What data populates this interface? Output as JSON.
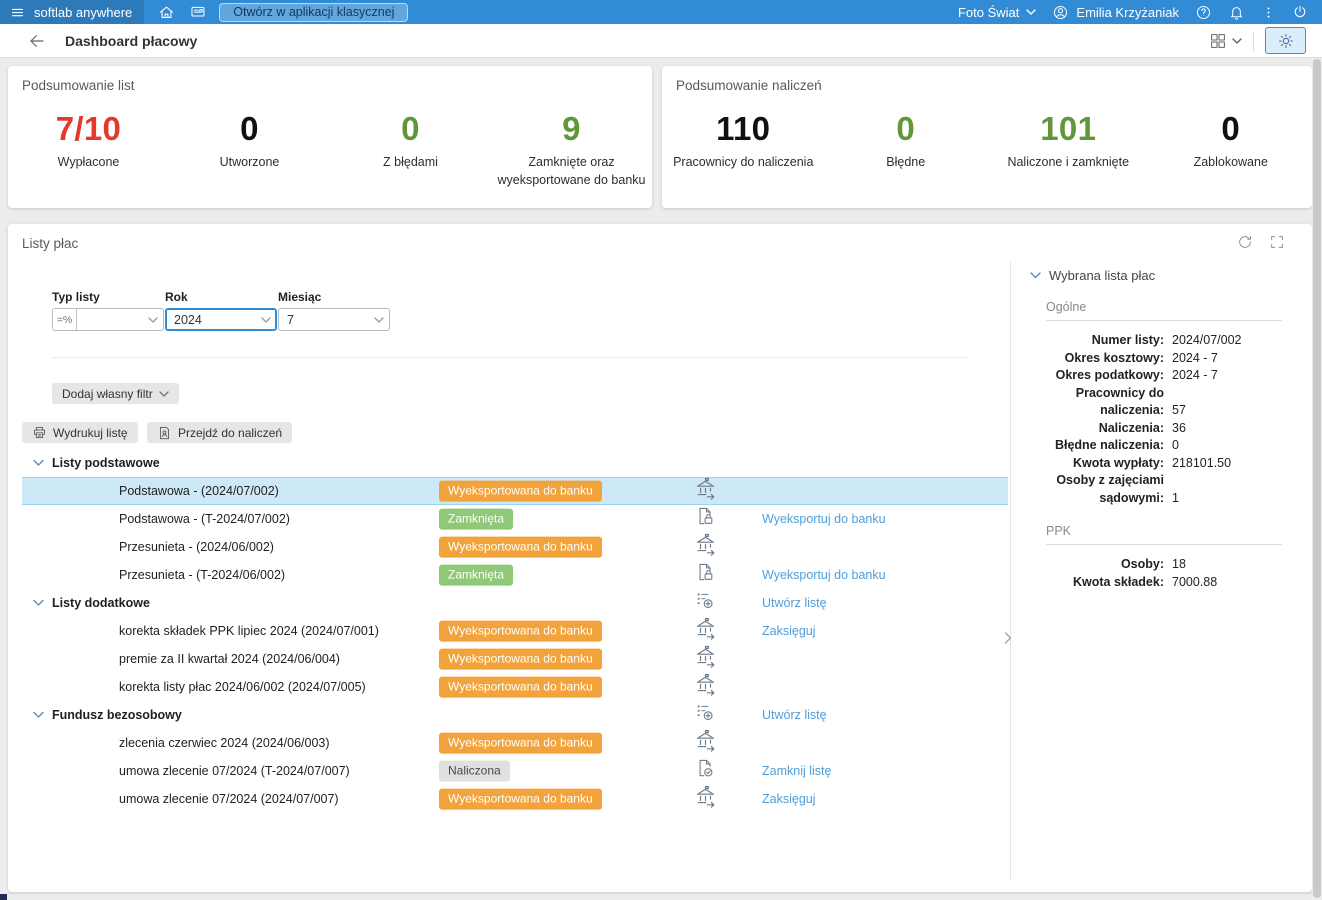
{
  "topbar": {
    "brand": "softlab anywhere",
    "open_classic_button": "Otwórz w aplikacji klasycznej",
    "company": "Foto Świat",
    "user": "Emilia Krzyżaniak"
  },
  "header": {
    "title": "Dashboard płacowy"
  },
  "summary_lists": {
    "title": "Podsumowanie list",
    "stats": [
      {
        "value": "7/10",
        "label": "Wypłacone",
        "color": "#e5392c"
      },
      {
        "value": "0",
        "label": "Utworzone",
        "color": "#111111"
      },
      {
        "value": "0",
        "label": "Z błędami",
        "color": "#61963b"
      },
      {
        "value": "9",
        "label": "Zamknięte oraz wyeksportowane do banku",
        "color": "#61963b"
      }
    ]
  },
  "summary_calcs": {
    "title": "Podsumowanie naliczeń",
    "stats": [
      {
        "value": "110",
        "label": "Pracownicy do naliczenia",
        "color": "#111111"
      },
      {
        "value": "0",
        "label": "Błędne",
        "color": "#61963b"
      },
      {
        "value": "101",
        "label": "Naliczone i zamknięte",
        "color": "#61963b"
      },
      {
        "value": "0",
        "label": "Zablokowane",
        "color": "#111111"
      }
    ]
  },
  "payroll": {
    "title": "Listy płac",
    "filters": {
      "type_label": "Typ listy",
      "operator_glyph": "=%",
      "type_value": "",
      "year_label": "Rok",
      "year_value": "2024",
      "month_label": "Miesiąc",
      "month_value": "7"
    },
    "add_filter_button": "Dodaj własny filtr",
    "print_button": "Wydrukuj listę",
    "goto_calcs_button": "Przejdź do naliczeń",
    "groups": [
      {
        "label": "Listy podstawowe",
        "icon": null,
        "action": "",
        "rows": [
          {
            "name": "Podstawowa - (2024/07/002)",
            "status": "Wyeksportowana do banku",
            "status_type": "exported",
            "icon": "bank-export-icon",
            "action": "",
            "selected": true
          },
          {
            "name": "Podstawowa - (T-2024/07/002)",
            "status": "Zamknięta",
            "status_type": "closed",
            "icon": "doc-lock-icon",
            "action": "Wyeksportuj do banku",
            "selected": false
          },
          {
            "name": "Przesunieta - (2024/06/002)",
            "status": "Wyeksportowana do banku",
            "status_type": "exported",
            "icon": "bank-export-icon",
            "action": "",
            "selected": false
          },
          {
            "name": "Przesunieta - (T-2024/06/002)",
            "status": "Zamknięta",
            "status_type": "closed",
            "icon": "doc-lock-icon",
            "action": "Wyeksportuj do banku",
            "selected": false
          }
        ]
      },
      {
        "label": "Listy dodatkowe",
        "icon": "list-add-icon",
        "action": "Utwórz listę",
        "rows": [
          {
            "name": "korekta składek PPK lipiec 2024 (2024/07/001)",
            "status": "Wyeksportowana do banku",
            "status_type": "exported",
            "icon": "bank-export-icon",
            "action": "Zaksięguj",
            "selected": false
          },
          {
            "name": "premie za II kwartał 2024 (2024/06/004)",
            "status": "Wyeksportowana do banku",
            "status_type": "exported",
            "icon": "bank-export-icon",
            "action": "",
            "selected": false
          },
          {
            "name": "korekta listy płac 2024/06/002 (2024/07/005)",
            "status": "Wyeksportowana do banku",
            "status_type": "exported",
            "icon": "bank-export-icon",
            "action": "",
            "selected": false
          }
        ]
      },
      {
        "label": "Fundusz bezosobowy",
        "icon": "list-add-icon",
        "action": "Utwórz listę",
        "rows": [
          {
            "name": "zlecenia czerwiec 2024 (2024/06/003)",
            "status": "Wyeksportowana do banku",
            "status_type": "exported",
            "icon": "bank-export-icon",
            "action": "",
            "selected": false
          },
          {
            "name": "umowa zlecenie 07/2024 (T-2024/07/007)",
            "status": "Naliczona",
            "status_type": "calculated",
            "icon": "doc-check-icon",
            "action": "Zamknij listę",
            "selected": false
          },
          {
            "name": "umowa zlecenie 07/2024 (2024/07/007)",
            "status": "Wyeksportowana do banku",
            "status_type": "exported",
            "icon": "bank-export-icon",
            "action": "Zaksięguj",
            "selected": false
          }
        ]
      }
    ]
  },
  "details_panel": {
    "title": "Wybrana lista płac",
    "sections": [
      {
        "heading": "Ogólne",
        "rows": [
          {
            "label": "Numer listy:",
            "value": "2024/07/002"
          },
          {
            "label": "Okres kosztowy:",
            "value": "2024 - 7"
          },
          {
            "label": "Okres podatkowy:",
            "value": "2024 - 7"
          },
          {
            "label": "Pracownicy do naliczenia:",
            "value": "57"
          },
          {
            "label": "Naliczenia:",
            "value": "36"
          },
          {
            "label": "Błędne naliczenia:",
            "value": "0"
          },
          {
            "label": "Kwota wypłaty:",
            "value": "218101.50"
          },
          {
            "label": "Osoby z zajęciami sądowymi:",
            "value": "1"
          }
        ]
      },
      {
        "heading": "PPK",
        "rows": [
          {
            "label": "Osoby:",
            "value": "18"
          },
          {
            "label": "Kwota składek:",
            "value": "7000.88"
          }
        ]
      }
    ]
  },
  "theme": {
    "topbar_blue": "#318bd5",
    "topbar_brand_blue": "#2d7abb",
    "selected_row": "#cde9f8",
    "link": "#4f9ed9",
    "status_colors": {
      "exported": "#f2a33b",
      "closed": "#8fc876",
      "calculated": "#e0e0e0"
    },
    "status_text": {
      "exported": "#ffffff",
      "closed": "#ffffff",
      "calculated": "#4a4a4a"
    }
  }
}
